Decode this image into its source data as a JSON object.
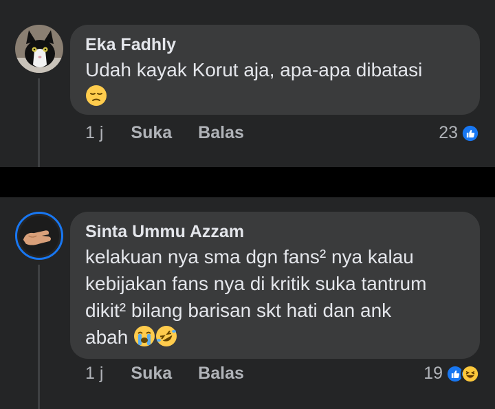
{
  "comments": [
    {
      "author": "Eka Fadhly",
      "text": "Udah kayak Korut aja, apa-apa dibatasi",
      "emoji_icons": [
        "pensive-face-icon"
      ],
      "time": "1 j",
      "like_label": "Suka",
      "reply_label": "Balas",
      "reaction_count": "23",
      "reaction_icons": [
        "like-reaction-icon"
      ]
    },
    {
      "author": "Sinta Ummu Azzam",
      "text_lines": [
        "kelakuan nya sma dgn fans² nya kalau",
        "kebijakan fans nya di kritik suka tantrum",
        "dikit² bilang barisan skt hati dan ank",
        "abah"
      ],
      "emoji_icons": [
        "loudly-crying-face-icon",
        "rolling-laughing-face-icon"
      ],
      "time": "1 j",
      "like_label": "Suka",
      "reply_label": "Balas",
      "reaction_count": "19",
      "reaction_icons": [
        "like-reaction-icon",
        "haha-reaction-icon"
      ]
    }
  ],
  "colors": {
    "background": "#242526",
    "bubble": "#3a3b3c",
    "text": "#e4e6eb",
    "secondary_text": "#b0b3b8",
    "accent": "#1877f2"
  }
}
